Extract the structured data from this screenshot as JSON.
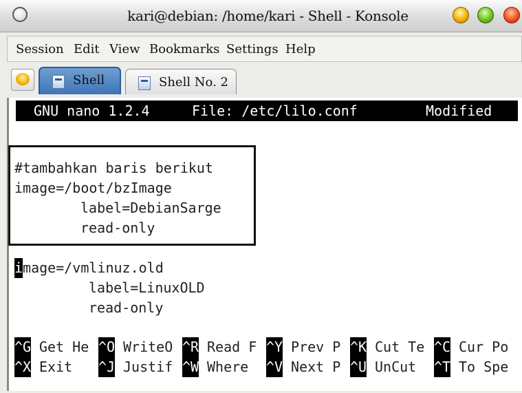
{
  "window": {
    "title": "kari@debian: /home/kari - Shell - Konsole"
  },
  "menu": [
    "Session",
    "Edit",
    "View",
    "Bookmarks",
    "Settings",
    "Help"
  ],
  "tabs": [
    {
      "label": "Shell",
      "active": true
    },
    {
      "label": "Shell No. 2",
      "active": false
    }
  ],
  "nano": {
    "version": "GNU nano 1.2.4",
    "file": "File: /etc/lilo.conf",
    "status": "Modified"
  },
  "content": {
    "comment": "#tambahkan baris berikut",
    "image1": "image=/boot/bzImage",
    "label1": "label=DebianSarge",
    "ro1": "read-only",
    "image2_cursor": "i",
    "image2_rest": "mage=/vmlinuz.old",
    "label2": "label=LinuxOLD",
    "ro2": "read-only"
  },
  "shortcuts": {
    "row1": [
      {
        "key": "^G",
        "label": "Get He"
      },
      {
        "key": "^O",
        "label": "WriteO"
      },
      {
        "key": "^R",
        "label": "Read F"
      },
      {
        "key": "^Y",
        "label": "Prev P"
      },
      {
        "key": "^K",
        "label": "Cut Te"
      },
      {
        "key": "^C",
        "label": "Cur Po"
      }
    ],
    "row2": [
      {
        "key": "^X",
        "label": "Exit"
      },
      {
        "key": "^J",
        "label": "Justif"
      },
      {
        "key": "^W",
        "label": "Where"
      },
      {
        "key": "^V",
        "label": "Next P"
      },
      {
        "key": "^U",
        "label": "UnCut"
      },
      {
        "key": "^T",
        "label": "To Spe"
      }
    ]
  },
  "colors": {
    "active_tab": "#4a7fc0",
    "terminal_bg": "#ffffff",
    "nano_header_bg": "#000000"
  }
}
